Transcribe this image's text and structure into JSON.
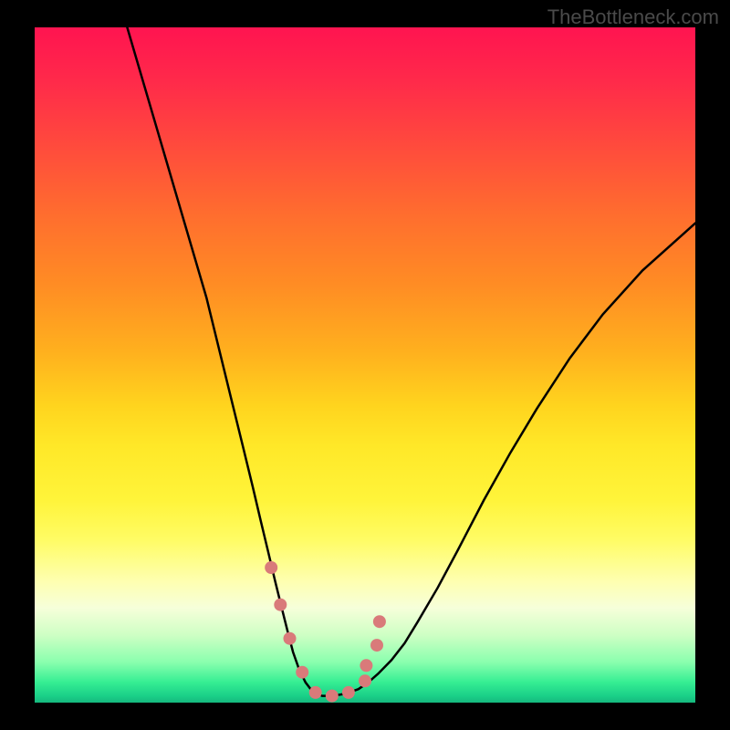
{
  "watermark": "TheBottleneck.com",
  "chart_data": {
    "type": "line",
    "title": "",
    "xlabel": "",
    "ylabel": "",
    "xlim": [
      0,
      100
    ],
    "ylim": [
      0,
      100
    ],
    "background_gradient": {
      "top": "#ff1450",
      "bottom": "#16b87e",
      "description": "red-orange-yellow-green vertical gradient"
    },
    "series": [
      {
        "name": "curve",
        "type": "line",
        "color": "#000000",
        "x": [
          14,
          17,
          20,
          23,
          26,
          28,
          30,
          31.5,
          33,
          34.2,
          35.3,
          36.4,
          37.4,
          38.3,
          39.1,
          40,
          41,
          42,
          43.5,
          45,
          47,
          49,
          50.5,
          52,
          54,
          56,
          58,
          61,
          64,
          68,
          72,
          76,
          81,
          86,
          92,
          100
        ],
        "y": [
          100,
          90,
          80,
          70,
          60,
          52,
          44,
          38,
          32,
          27,
          22.5,
          18,
          14,
          10.5,
          7.5,
          5,
          3,
          1.7,
          1,
          1,
          1.3,
          2,
          3,
          4.3,
          6.3,
          8.8,
          12,
          17,
          22.5,
          30,
          37,
          43.5,
          51,
          57.5,
          64,
          71
        ]
      },
      {
        "name": "markers",
        "type": "scatter",
        "color": "#d97a7a",
        "marker_size": 14,
        "x": [
          35.8,
          37.2,
          38.6,
          40.5,
          42.5,
          45,
          47.5,
          50,
          50.2,
          51.8,
          52.2
        ],
        "y": [
          20,
          14.5,
          9.5,
          4.5,
          1.5,
          1,
          1.5,
          3.2,
          5.5,
          8.5,
          12
        ]
      }
    ]
  }
}
